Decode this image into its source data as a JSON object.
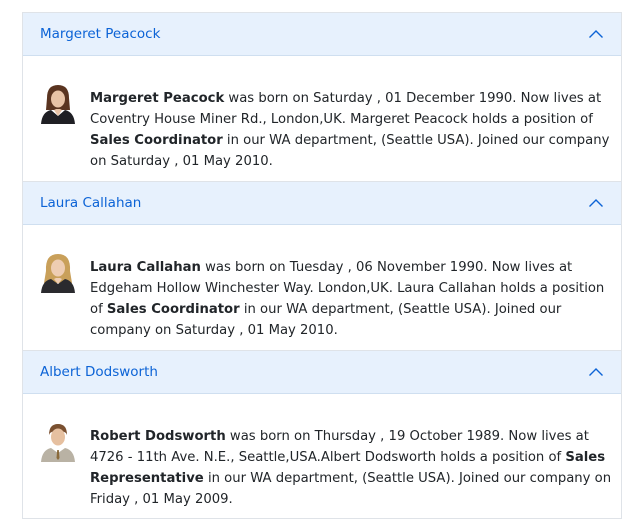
{
  "panels": [
    {
      "header": "Margeret Peacock",
      "name": "Margeret Peacock",
      "text1": " was born on Saturday , 01 December 1990. Now lives at Coventry House Miner Rd., London,UK. Margeret Peacock holds a position of ",
      "position": "Sales Coordinator",
      "text2": " in our WA department, (Seattle USA). Joined our company on Saturday , 01 May 2010.",
      "avatar_icon": "person-avatar-icon"
    },
    {
      "header": "Laura Callahan",
      "name": "Laura Callahan",
      "text1": " was born on Tuesday , 06 November 1990. Now lives at Edgeham Hollow Winchester Way. London,UK. Laura Callahan holds a position of ",
      "position": "Sales Coordinator",
      "text2": " in our WA department, (Seattle USA). Joined our company on Saturday , 01 May 2010.",
      "avatar_icon": "person-avatar-icon"
    },
    {
      "header": "Albert Dodsworth",
      "name": "Robert Dodsworth",
      "text1": " was born on Thursday , 19 October 1989. Now lives at 4726 - 11th Ave. N.E., Seattle,USA.Albert Dodsworth holds a position of ",
      "position": "Sales Representative",
      "text2": " in our WA department, (Seattle USA). Joined our company on Friday , 01 May 2009.",
      "avatar_icon": "person-avatar-icon"
    }
  ],
  "colors": {
    "header_bg": "#e7f1fd",
    "header_text": "#0c63d6",
    "border": "#dfe3e8"
  }
}
